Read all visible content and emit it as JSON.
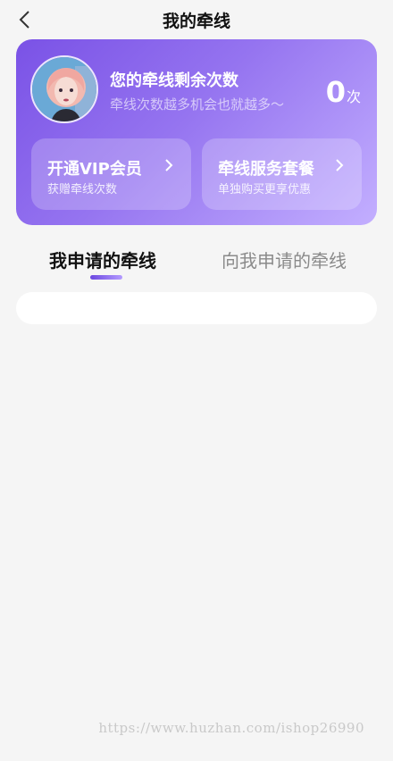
{
  "header": {
    "title": "我的牵线",
    "back_icon": "chevron-left-icon"
  },
  "card": {
    "title": "您的牵线剩余次数",
    "subtitle": "牵线次数越多机会也就越多～",
    "count": "0",
    "count_unit": "次",
    "vip": {
      "title": "开通VIP会员",
      "desc": "获赠牵线次数"
    },
    "service": {
      "title": "牵线服务套餐",
      "desc": "单独购买更享优惠"
    }
  },
  "tabs": [
    {
      "label": "我申请的牵线",
      "active": true
    },
    {
      "label": "向我申请的牵线",
      "active": false
    }
  ],
  "watermark": "https://www.huzhan.com/ishop26990",
  "colors": {
    "accent": "#7a52e6",
    "background": "#f5f5f5"
  }
}
